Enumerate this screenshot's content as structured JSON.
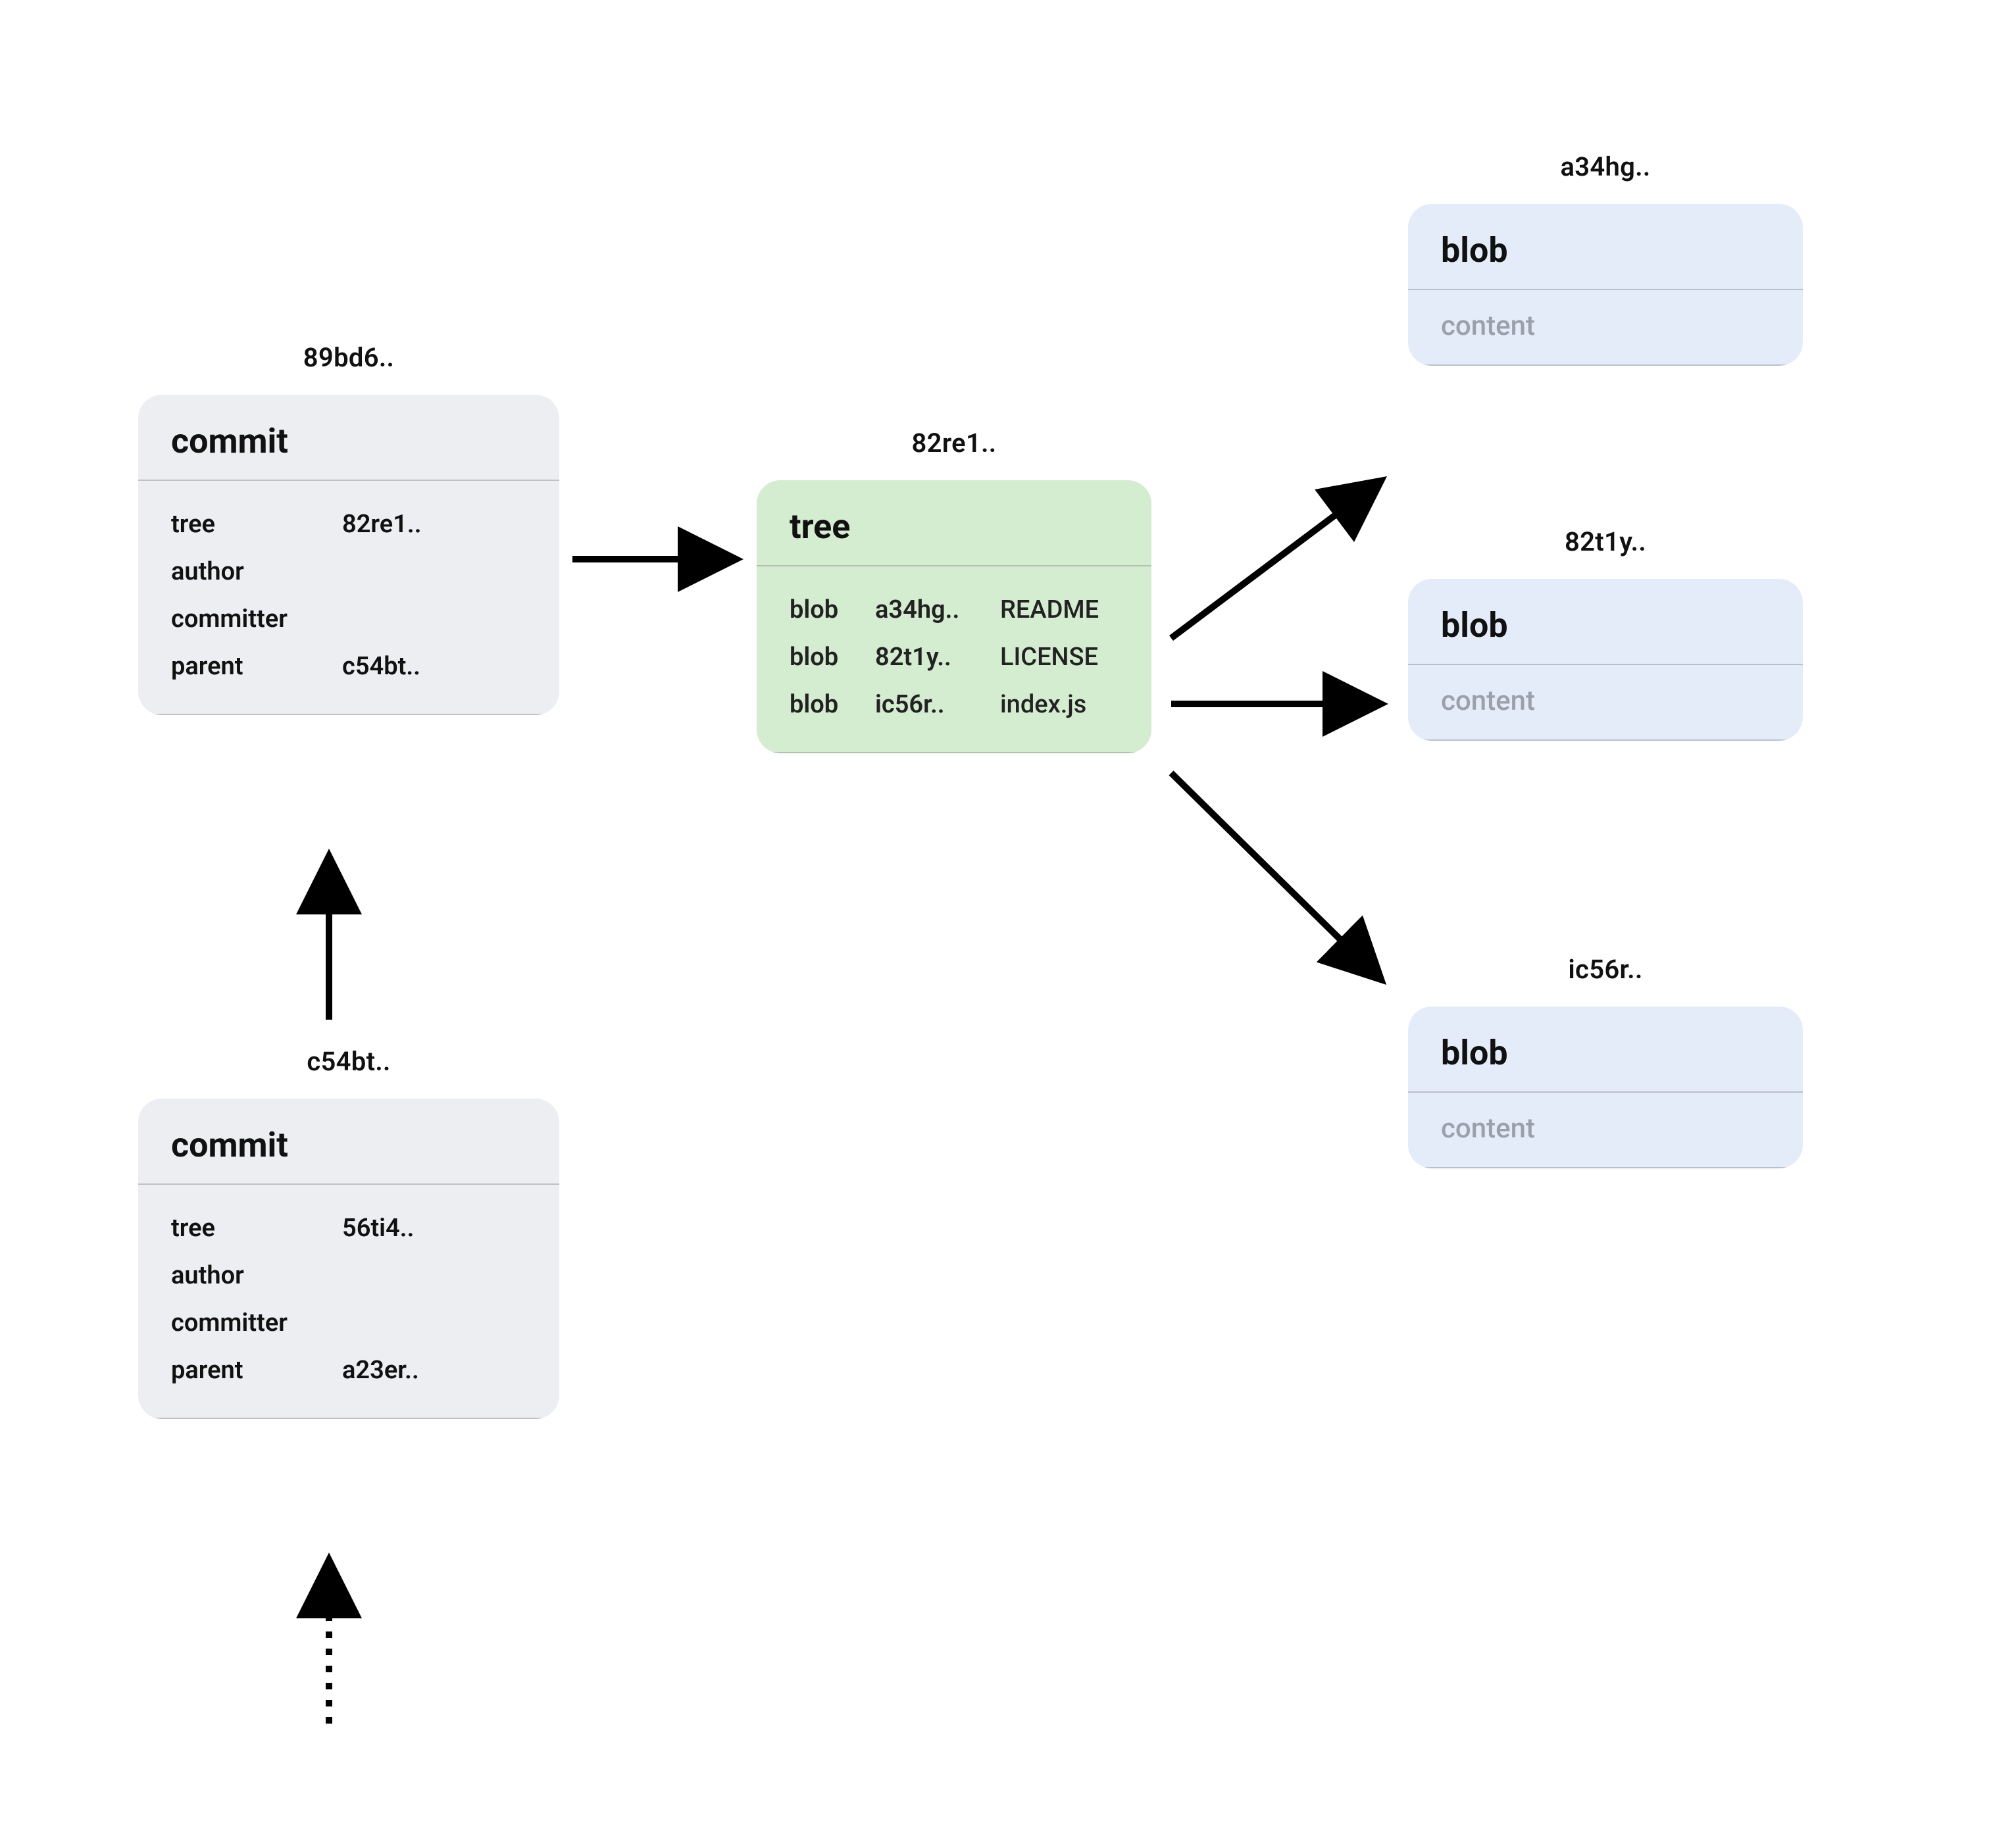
{
  "commit_top": {
    "hash": "89bd6..",
    "title": "commit",
    "rows": [
      {
        "key": "tree",
        "val": "82re1.."
      },
      {
        "key": "author",
        "val": ""
      },
      {
        "key": "committer",
        "val": ""
      },
      {
        "key": "parent",
        "val": "c54bt.."
      }
    ]
  },
  "commit_bottom": {
    "hash": "c54bt..",
    "title": "commit",
    "rows": [
      {
        "key": "tree",
        "val": "56ti4.."
      },
      {
        "key": "author",
        "val": ""
      },
      {
        "key": "committer",
        "val": ""
      },
      {
        "key": "parent",
        "val": "a23er.."
      }
    ]
  },
  "tree_box": {
    "hash": "82re1..",
    "title": "tree",
    "rows": [
      {
        "type": "blob",
        "hash": "a34hg..",
        "name": "README"
      },
      {
        "type": "blob",
        "hash": "82t1y..",
        "name": "LICENSE"
      },
      {
        "type": "blob",
        "hash": "ic56r..",
        "name": "index.js"
      }
    ]
  },
  "blob_a": {
    "hash": "a34hg..",
    "title": "blob",
    "body": "content"
  },
  "blob_b": {
    "hash": "82t1y..",
    "title": "blob",
    "body": "content"
  },
  "blob_c": {
    "hash": "ic56r..",
    "title": "blob",
    "body": "content"
  },
  "colors": {
    "commit": "#edeef2",
    "tree": "#d4ecd0",
    "blob": "#e4ecfa"
  }
}
